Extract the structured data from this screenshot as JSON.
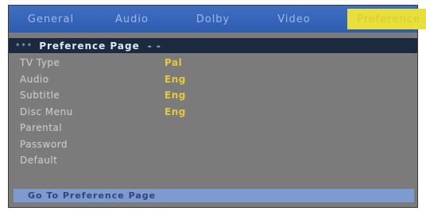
{
  "tabs": [
    {
      "label": "General"
    },
    {
      "label": "Audio"
    },
    {
      "label": "Dolby"
    },
    {
      "label": "Video"
    },
    {
      "label": "Preference"
    }
  ],
  "section": {
    "bullet": "•••",
    "title": "Preference Page",
    "ellipsis": "- -"
  },
  "rows": [
    {
      "label": "TV Type",
      "value": "Pal"
    },
    {
      "label": "Audio",
      "value": "Eng"
    },
    {
      "label": "Subtitle",
      "value": "Eng"
    },
    {
      "label": "Disc Menu",
      "value": "Eng"
    },
    {
      "label": "Parental",
      "value": ""
    },
    {
      "label": "Password",
      "value": ""
    },
    {
      "label": "Default",
      "value": ""
    }
  ],
  "footer": {
    "text": "Go To Preference Page"
  },
  "colors": {
    "tab_bar": "#3f6fc2",
    "active_tab": "#e9df3a",
    "section_bar": "#1b2a3e",
    "panel": "#7b7b7b",
    "value_text": "#e7c93a",
    "footer": "#7d9bcf"
  }
}
